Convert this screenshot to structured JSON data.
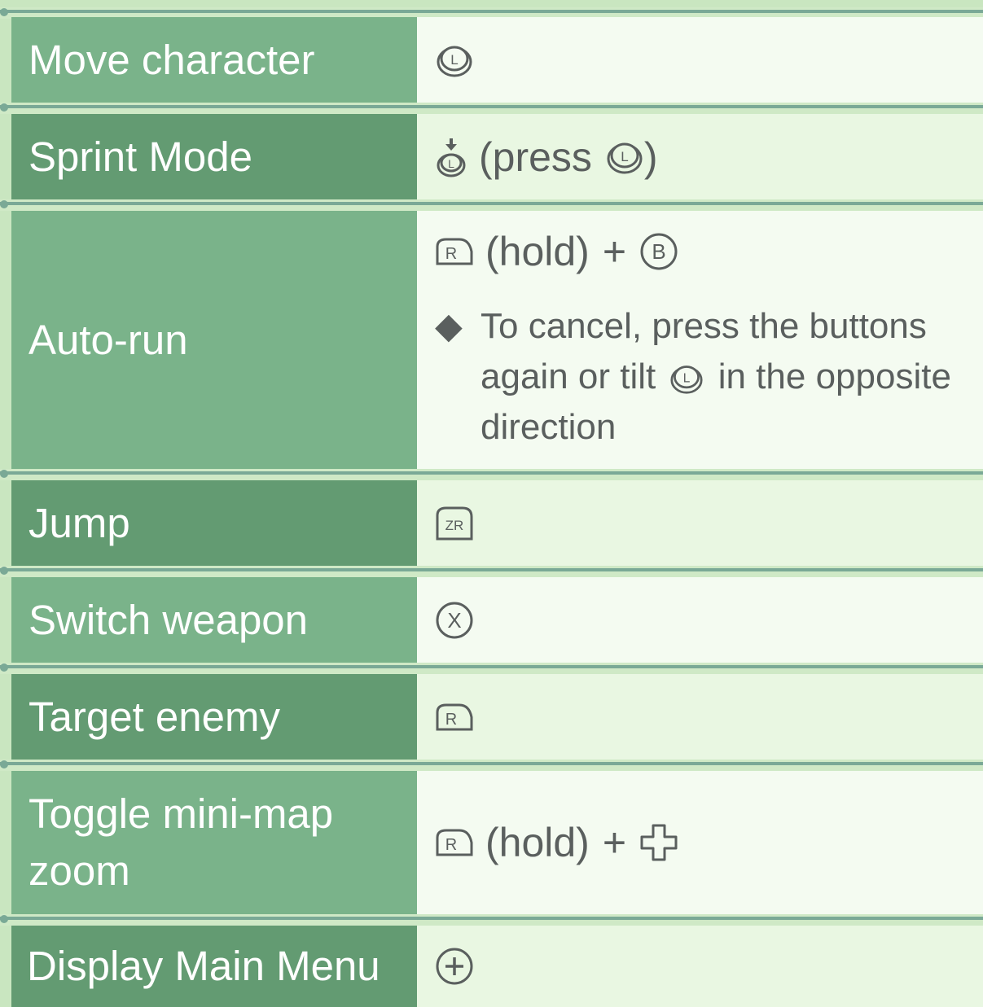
{
  "rows": [
    {
      "label": "Move character",
      "icon": "left-stick-icon"
    },
    {
      "label": "Sprint Mode",
      "icon": "left-stick-press-icon",
      "press_open": "(press",
      "press_close": ")",
      "press_icon": "left-stick-icon"
    },
    {
      "label": "Auto-run",
      "icon": "r-button-icon",
      "hold": "(hold)",
      "plus": "+",
      "second_icon": "b-button-icon",
      "note_bullet": "◆",
      "note_part1": "To cancel, press the buttons again or tilt",
      "note_icon": "left-stick-icon",
      "note_part2": "in the opposite direction"
    },
    {
      "label": "Jump",
      "icon": "zr-button-icon"
    },
    {
      "label": "Switch weapon",
      "icon": "x-button-icon"
    },
    {
      "label": "Target enemy",
      "icon": "r-button-icon"
    },
    {
      "label": "Toggle mini-map zoom",
      "icon": "r-button-icon",
      "hold": "(hold)",
      "plus": "+",
      "second_icon": "dpad-icon"
    },
    {
      "label": "Display Main Menu",
      "icon": "plus-button-icon"
    }
  ],
  "colors": {
    "label_light": "#7ab38a",
    "label_dark": "#639b72",
    "value_light": "#f4fbf1",
    "value_dark": "#e9f7e2",
    "separator": "#7aa996",
    "text": "#5a5f5e"
  }
}
